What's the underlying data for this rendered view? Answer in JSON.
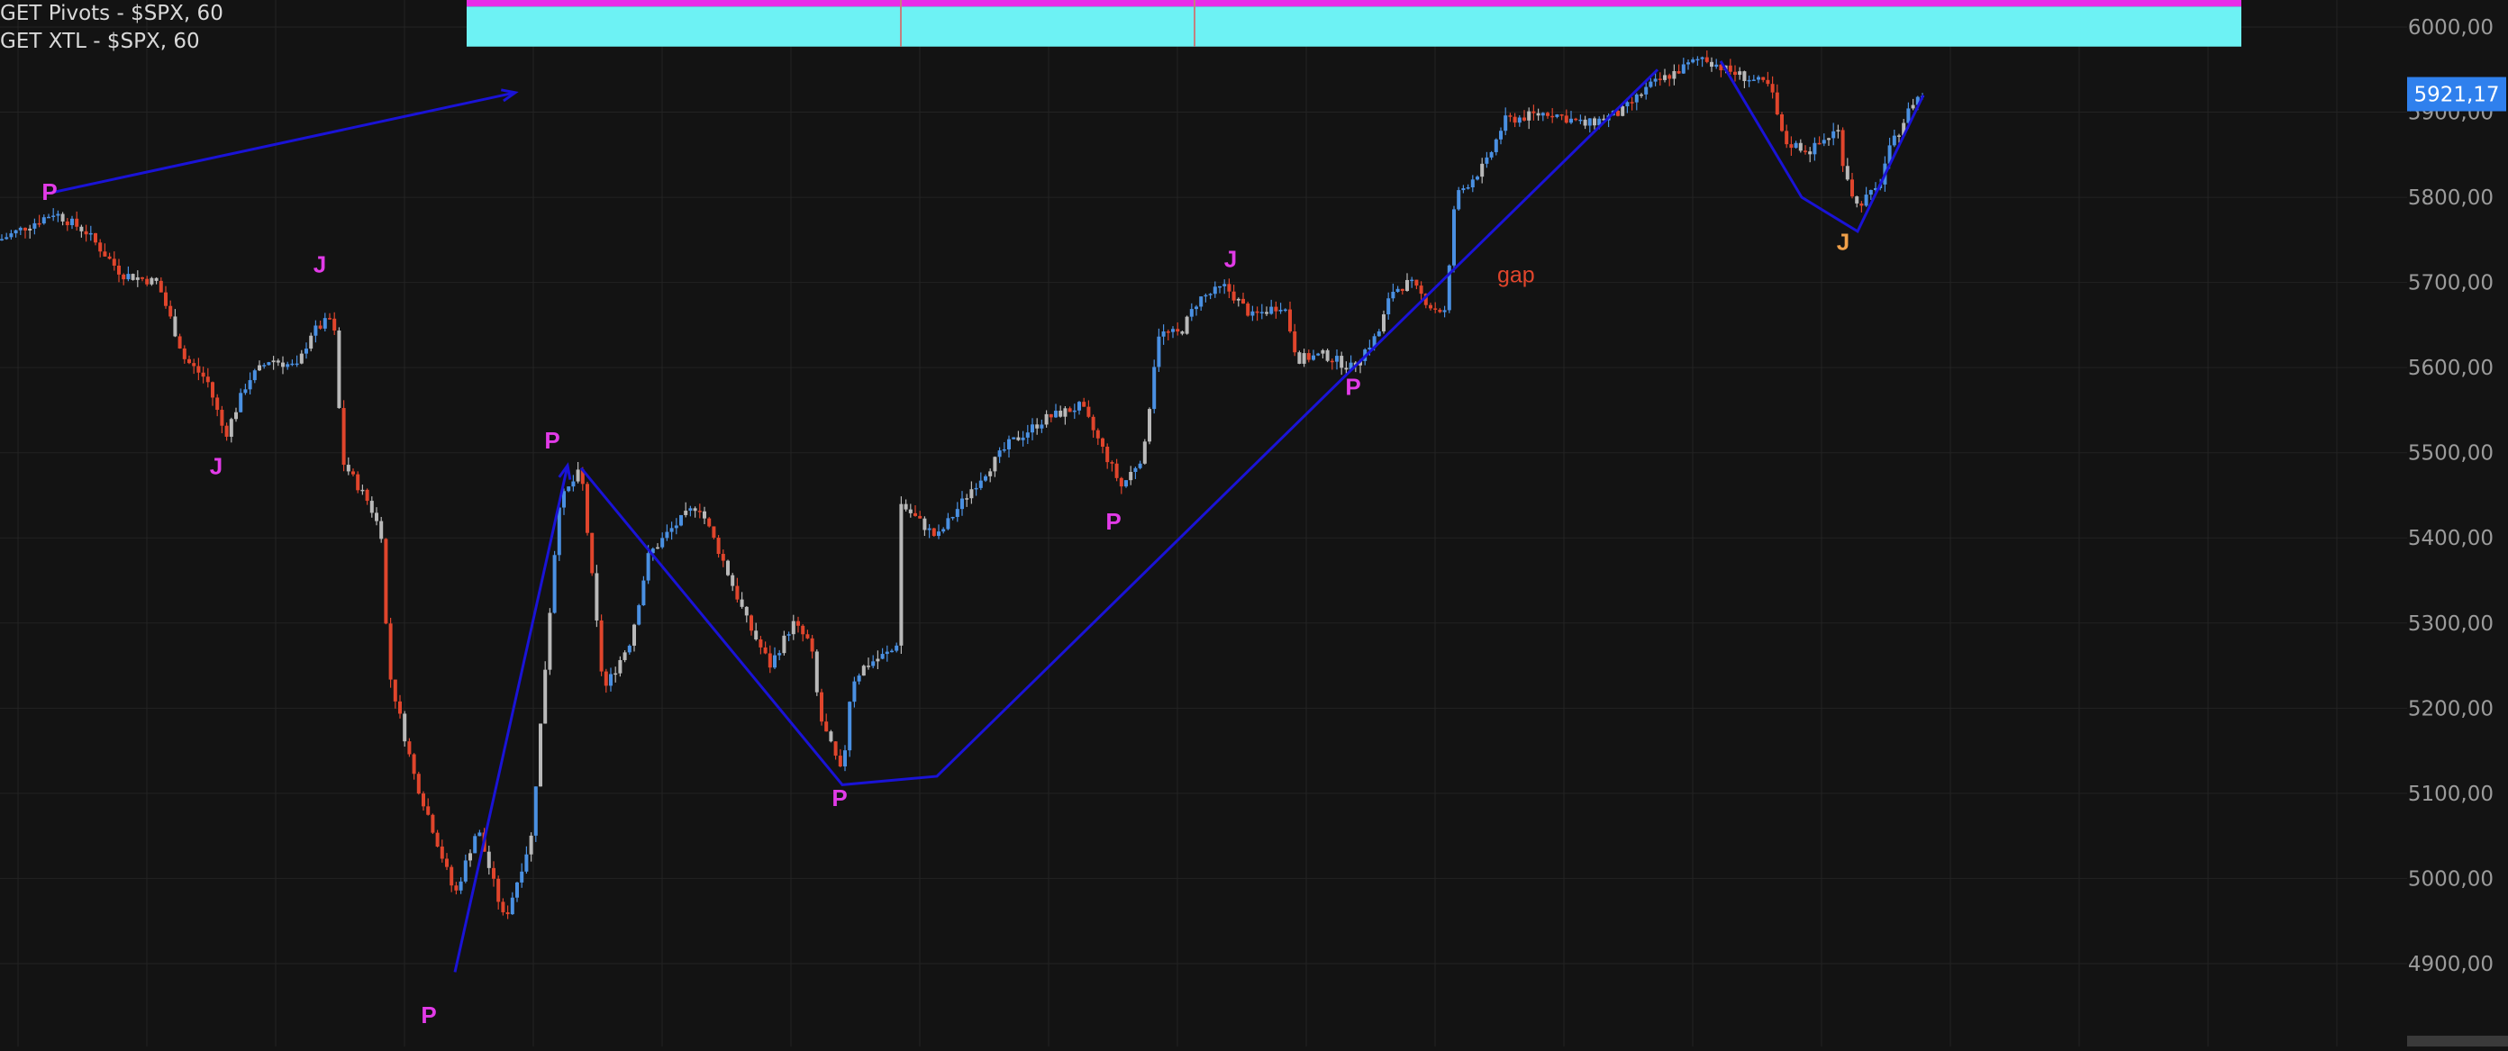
{
  "indicators": [
    {
      "label": "GET Pivots - $SPX, 60"
    },
    {
      "label": "GET XTL - $SPX, 60"
    }
  ],
  "colors": {
    "background": "#131313",
    "grid": "#232323",
    "up": "#4a90e2",
    "down": "#e0452c",
    "neutral": "#b9b9b9",
    "wave_line": "#1a13d6",
    "label_p": "#e23be8",
    "label_j": "#e23be8",
    "label_j_last": "#f0a04a",
    "gap_text": "#e0452c",
    "zone_magenta": "#e82de8",
    "zone_cyan": "#6df2f4",
    "price_badge": "#2f80ed",
    "axis_text": "#9b9b9b"
  },
  "chart_data": {
    "type": "candlestick",
    "symbol": "$SPX",
    "interval": "60",
    "ylim": [
      4820,
      6080
    ],
    "y_ticks": [
      "6000,00",
      "5900,00",
      "5800,00",
      "5700,00",
      "5600,00",
      "5500,00",
      "5400,00",
      "5300,00",
      "5200,00",
      "5100,00",
      "5000,00",
      "4900,00"
    ],
    "last_price": "5921,17",
    "price_path": [
      [
        0,
        5750
      ],
      [
        60,
        5782
      ],
      [
        95,
        5760
      ],
      [
        135,
        5710
      ],
      [
        175,
        5700
      ],
      [
        205,
        5610
      ],
      [
        230,
        5585
      ],
      [
        250,
        5520
      ],
      [
        275,
        5585
      ],
      [
        300,
        5610
      ],
      [
        330,
        5600
      ],
      [
        345,
        5640
      ],
      [
        370,
        5660
      ],
      [
        380,
        5490
      ],
      [
        410,
        5440
      ],
      [
        425,
        5400
      ],
      [
        430,
        5250
      ],
      [
        460,
        5120
      ],
      [
        480,
        5060
      ],
      [
        505,
        4980
      ],
      [
        530,
        5060
      ],
      [
        560,
        4950
      ],
      [
        590,
        5050
      ],
      [
        620,
        5440
      ],
      [
        645,
        5480
      ],
      [
        670,
        5220
      ],
      [
        700,
        5280
      ],
      [
        720,
        5380
      ],
      [
        745,
        5410
      ],
      [
        775,
        5440
      ],
      [
        800,
        5380
      ],
      [
        830,
        5300
      ],
      [
        855,
        5250
      ],
      [
        880,
        5300
      ],
      [
        900,
        5275
      ],
      [
        910,
        5190
      ],
      [
        935,
        5120
      ],
      [
        945,
        5230
      ],
      [
        960,
        5250
      ],
      [
        995,
        5270
      ],
      [
        1000,
        5440
      ],
      [
        1040,
        5400
      ],
      [
        1080,
        5460
      ],
      [
        1120,
        5510
      ],
      [
        1160,
        5540
      ],
      [
        1200,
        5555
      ],
      [
        1245,
        5460
      ],
      [
        1270,
        5500
      ],
      [
        1285,
        5640
      ],
      [
        1310,
        5640
      ],
      [
        1330,
        5680
      ],
      [
        1360,
        5695
      ],
      [
        1390,
        5660
      ],
      [
        1425,
        5675
      ],
      [
        1440,
        5610
      ],
      [
        1470,
        5615
      ],
      [
        1500,
        5600
      ],
      [
        1530,
        5640
      ],
      [
        1545,
        5690
      ],
      [
        1565,
        5700
      ],
      [
        1590,
        5670
      ],
      [
        1605,
        5665
      ],
      [
        1615,
        5800
      ],
      [
        1650,
        5840
      ],
      [
        1670,
        5890
      ],
      [
        1720,
        5900
      ],
      [
        1760,
        5885
      ],
      [
        1800,
        5900
      ],
      [
        1830,
        5930
      ],
      [
        1865,
        5950
      ],
      [
        1890,
        5965
      ],
      [
        1915,
        5950
      ],
      [
        1940,
        5940
      ],
      [
        1965,
        5930
      ],
      [
        1980,
        5865
      ],
      [
        2010,
        5855
      ],
      [
        2040,
        5880
      ],
      [
        2045,
        5845
      ],
      [
        2060,
        5790
      ],
      [
        2085,
        5810
      ],
      [
        2095,
        5850
      ],
      [
        2125,
        5915
      ],
      [
        2135,
        5921
      ]
    ],
    "wave_lines": [
      {
        "points": [
          [
            55,
            5805
          ],
          [
            572,
            5923
          ]
        ],
        "arrow": true
      },
      {
        "points": [
          [
            505,
            4890
          ],
          [
            630,
            5485
          ]
        ],
        "arrow": true
      },
      {
        "points": [
          [
            645,
            5482
          ],
          [
            935,
            5110
          ],
          [
            1040,
            5120
          ],
          [
            1840,
            5950
          ]
        ],
        "arrow": false
      },
      {
        "points": [
          [
            1910,
            5960
          ],
          [
            2000,
            5800
          ],
          [
            2062,
            5760
          ],
          [
            2135,
            5920
          ]
        ],
        "arrow": false
      }
    ],
    "pivot_labels": [
      {
        "text": "P",
        "x": 55,
        "y": 5797,
        "color_key": "label_p"
      },
      {
        "text": "J",
        "x": 355,
        "y": 5712,
        "color_key": "label_j"
      },
      {
        "text": "J",
        "x": 240,
        "y": 5475,
        "color_key": "label_j"
      },
      {
        "text": "P",
        "x": 613,
        "y": 5505,
        "color_key": "label_p"
      },
      {
        "text": "P",
        "x": 476,
        "y": 4830,
        "color_key": "label_p"
      },
      {
        "text": "P",
        "x": 932,
        "y": 5085,
        "color_key": "label_p"
      },
      {
        "text": "P",
        "x": 1236,
        "y": 5410,
        "color_key": "label_p"
      },
      {
        "text": "J",
        "x": 1366,
        "y": 5718,
        "color_key": "label_j"
      },
      {
        "text": "P",
        "x": 1502,
        "y": 5568,
        "color_key": "label_p"
      },
      {
        "text": "J",
        "x": 2046,
        "y": 5738,
        "color_key": "label_j_last"
      }
    ],
    "annotations": [
      {
        "text": "gap",
        "x": 1662,
        "y": 5700
      }
    ],
    "zones": [
      {
        "x0": 518,
        "x1": 2488,
        "y_top": 6070,
        "y_bottom": 6024,
        "color_key": "zone_magenta"
      },
      {
        "x0": 518,
        "x1": 2488,
        "y_top": 6024,
        "y_bottom": 5977,
        "color_key": "zone_cyan"
      }
    ],
    "zone_dividers": [
      1000,
      1326
    ]
  }
}
